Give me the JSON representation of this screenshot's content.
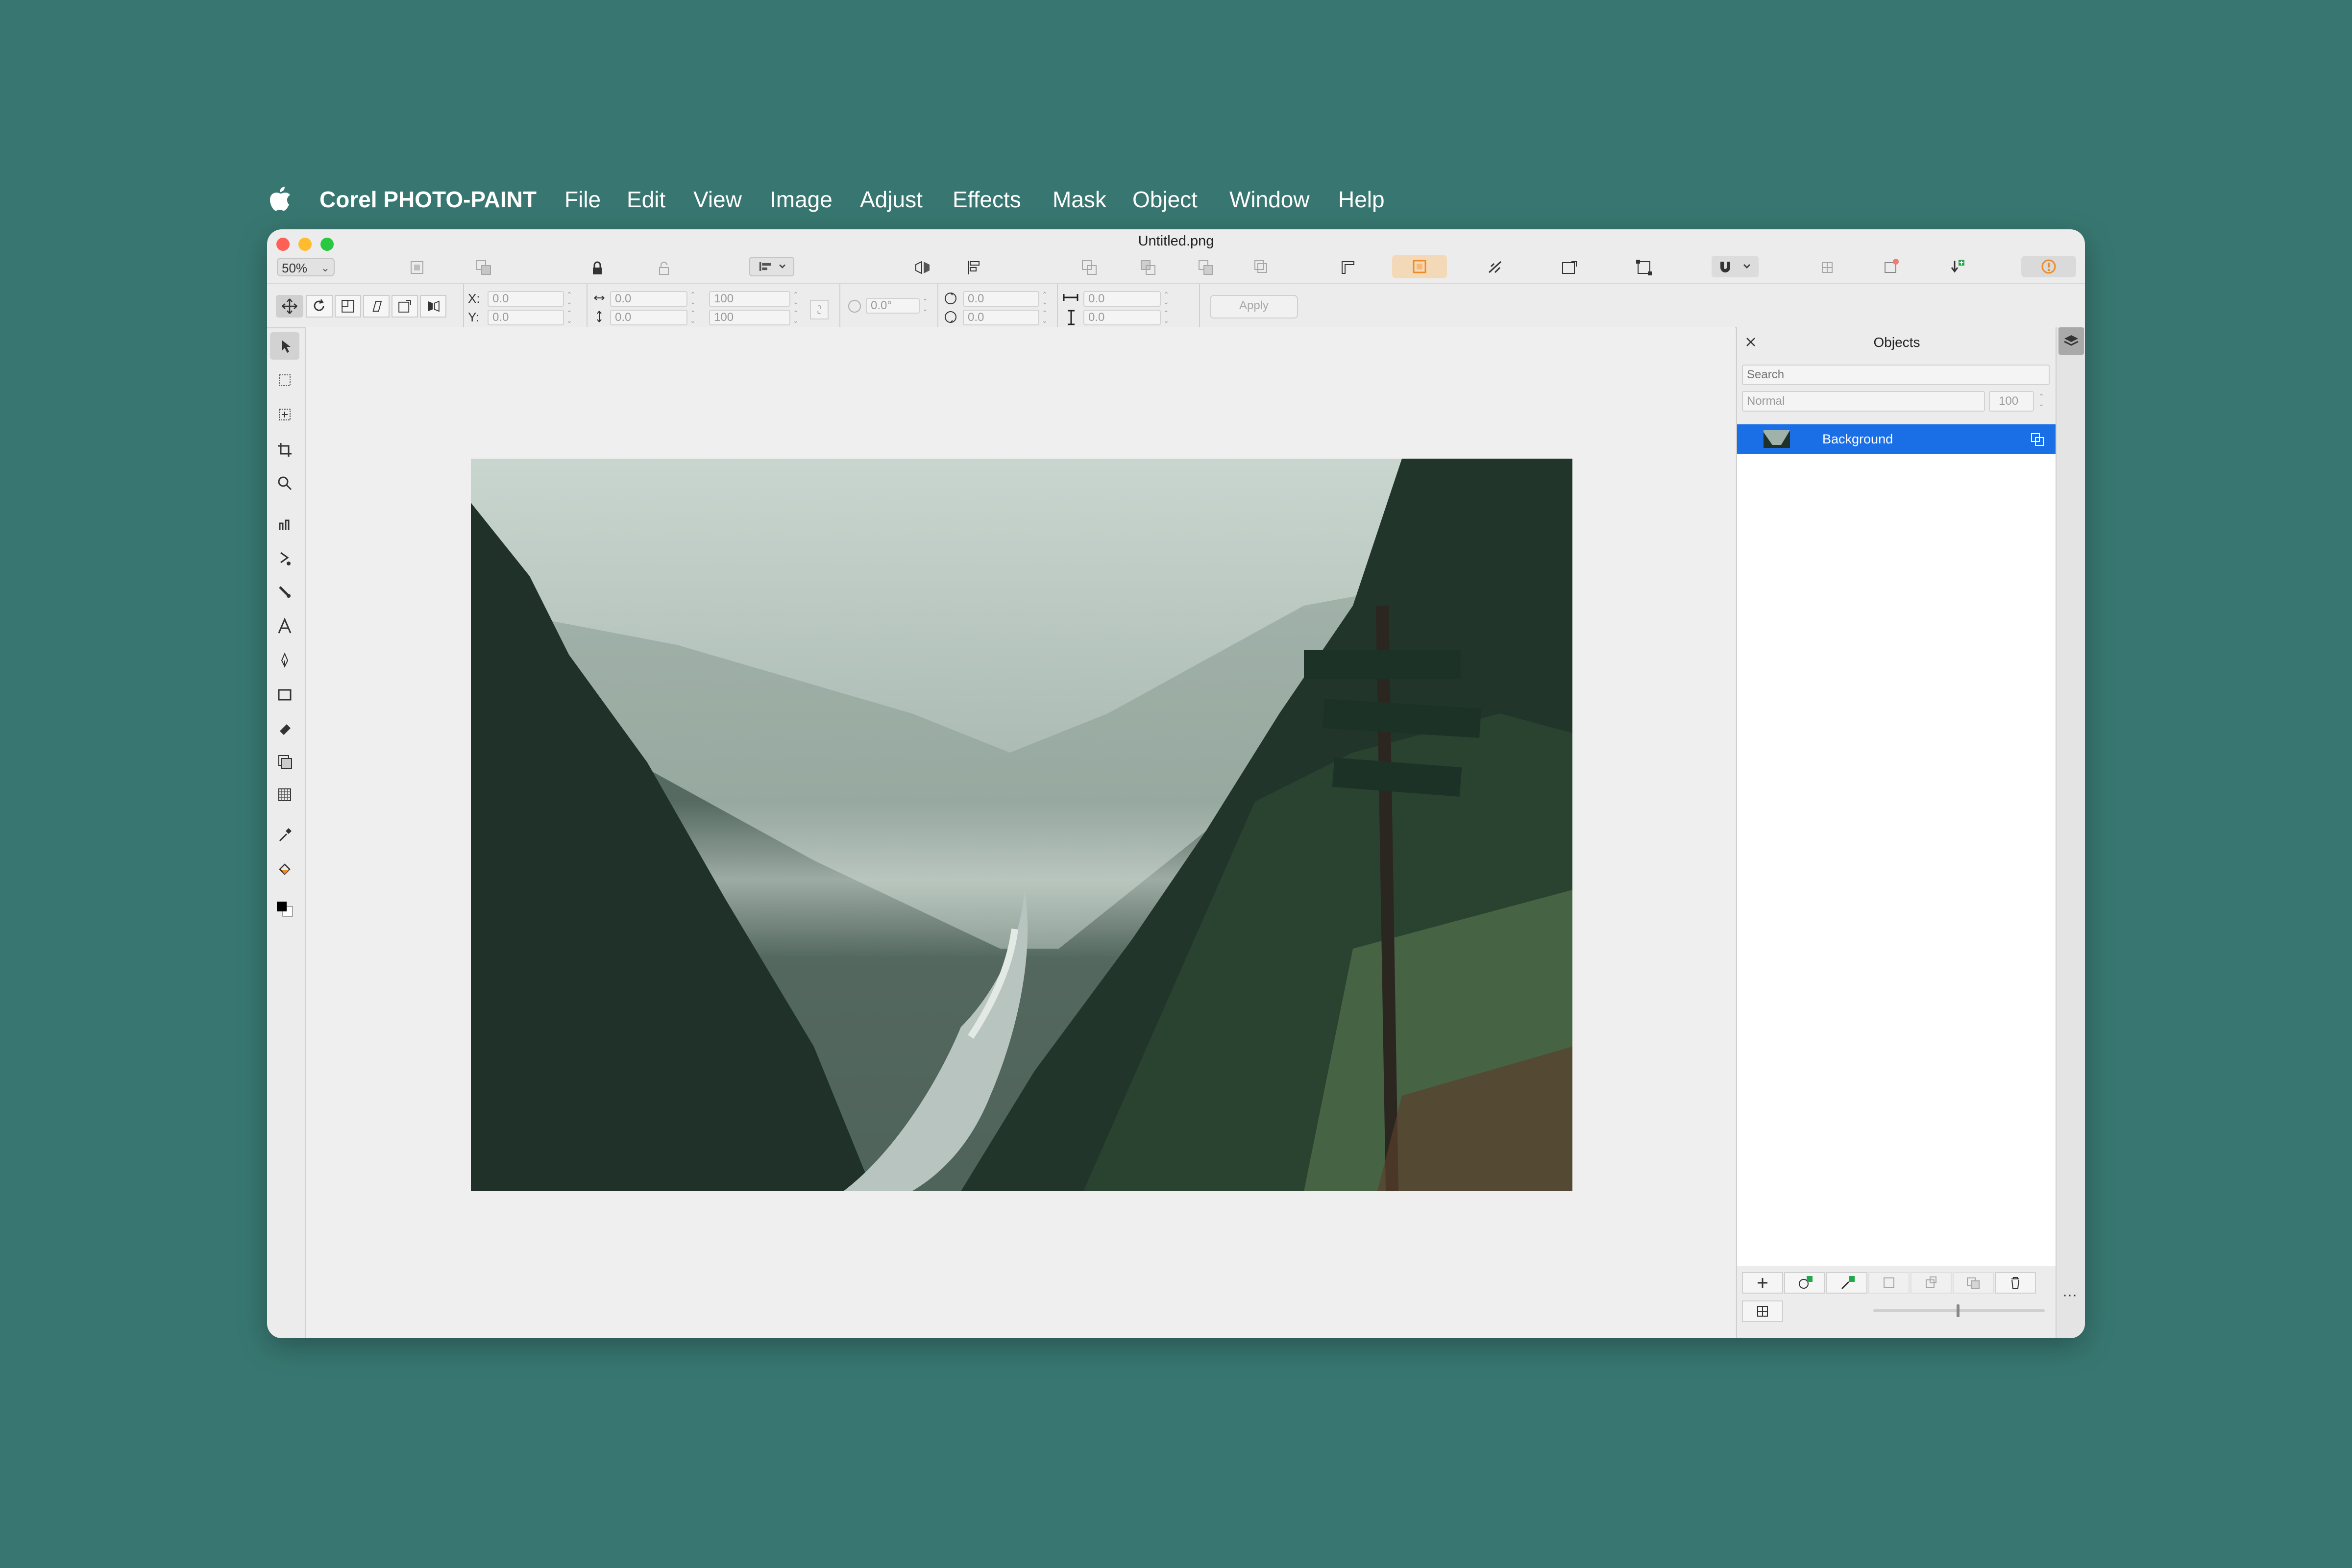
{
  "menubar": {
    "app_name": "Corel PHOTO-PAINT",
    "items": [
      "File",
      "Edit",
      "View",
      "Image",
      "Adjust",
      "Effects",
      "Mask",
      "Object",
      "Window",
      "Help"
    ]
  },
  "window": {
    "title": "Untitled.png",
    "zoom": "50%"
  },
  "property_bar": {
    "x_label": "X:",
    "y_label": "Y:",
    "x_value": "0.0",
    "y_value": "0.0",
    "width_value": "0.0",
    "height_value": "0.0",
    "scale_w": "100",
    "scale_h": "100",
    "lock_ratio_icon": "link-icon",
    "rotation": "0.0°",
    "center_x": "0.0",
    "center_y": "0.0",
    "skew_h": "0.0",
    "skew_v": "0.0",
    "apply_label": "Apply"
  },
  "objects_panel": {
    "title": "Objects",
    "search_placeholder": "Search",
    "blend_mode": "Normal",
    "opacity": "100",
    "objects": [
      {
        "name": "Background",
        "selected": true
      }
    ]
  },
  "colors": {
    "background": "#387771",
    "selection": "#1a6fe6",
    "accent_orange": "#f08a24"
  }
}
